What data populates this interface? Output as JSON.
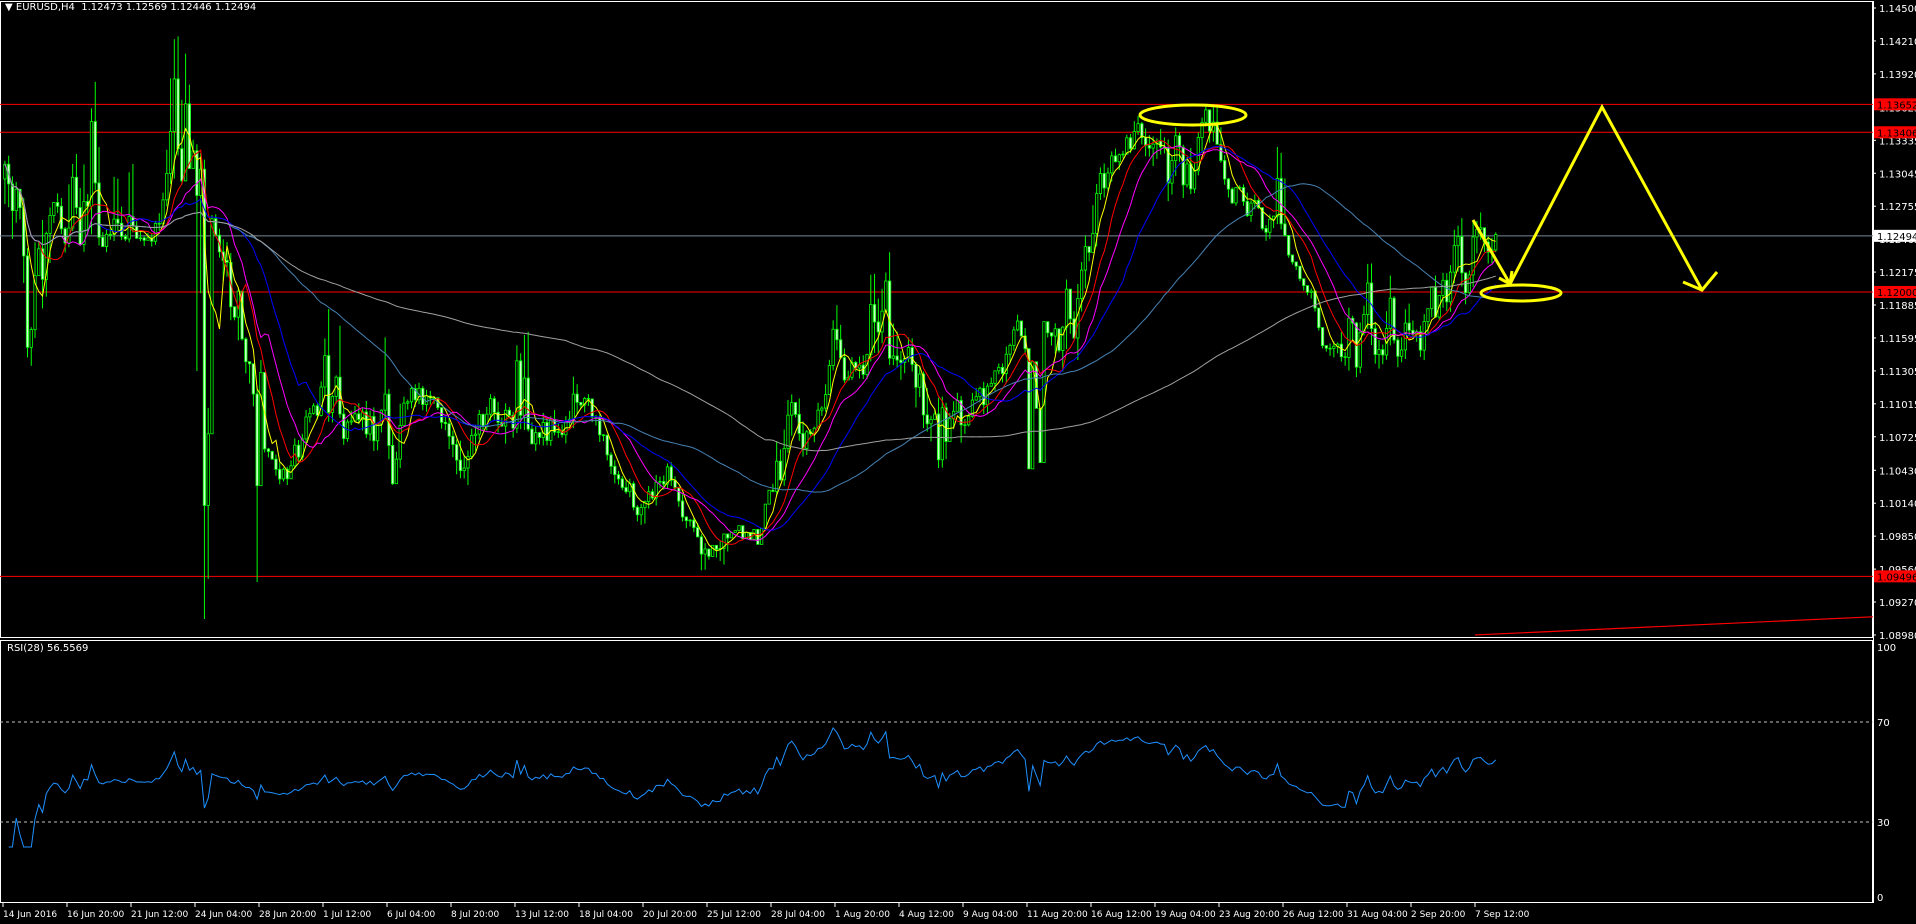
{
  "header": {
    "symbol": "EURUSD,H4",
    "ohlc_text": "1.12473 1.12569 1.12446 1.12494",
    "menu_icon": "triangle-down-icon"
  },
  "chart_data": {
    "type": "candlestick",
    "title": "EURUSD,H4",
    "ylim": [
      1.0898,
      1.145
    ],
    "grid": false,
    "colors": {
      "background": "#000000",
      "candle": "#00ff00",
      "bear_body": "#ccffcc",
      "axis": "#ffffff",
      "level_line": "#ff0000",
      "current_price_line": "#778899",
      "annotation": "#ffff00"
    },
    "x_tick_labels": [
      "14 Jun 2016",
      "16 Jun 20:00",
      "21 Jun 12:00",
      "24 Jun 04:00",
      "28 Jun 20:00",
      "1 Jul 12:00",
      "6 Jul 04:00",
      "8 Jul 20:00",
      "13 Jul 12:00",
      "18 Jul 04:00",
      "20 Jul 20:00",
      "25 Jul 12:00",
      "28 Jul 04:00",
      "1 Aug 20:00",
      "4 Aug 12:00",
      "9 Aug 04:00",
      "11 Aug 20:00",
      "16 Aug 12:00",
      "19 Aug 04:00",
      "23 Aug 20:00",
      "26 Aug 12:00",
      "31 Aug 04:00",
      "2 Sep 20:00",
      "7 Sep 12:00"
    ],
    "y_tick_labels": [
      "1.14500",
      "1.14210",
      "1.13920",
      "1.13625",
      "1.13335",
      "1.13045",
      "1.12755",
      "1.12465",
      "1.12175",
      "1.11885",
      "1.11595",
      "1.11305",
      "1.11015",
      "1.10725",
      "1.10430",
      "1.10140",
      "1.09850",
      "1.09560",
      "1.09270",
      "1.08980"
    ],
    "segments": [
      {
        "from": "14 Jun 2016",
        "open": 1.13,
        "high": 1.132,
        "low": 1.1135,
        "close": 1.1245
      },
      {
        "from": "16 Jun 20:00",
        "open": 1.1245,
        "high": 1.1385,
        "low": 1.1235,
        "close": 1.1265
      },
      {
        "from": "21 Jun 12:00",
        "open": 1.1265,
        "high": 1.1425,
        "low": 1.124,
        "close": 1.132
      },
      {
        "from": "24 Jun 04:00",
        "open": 1.132,
        "high": 1.133,
        "low": 1.0912,
        "close": 1.106
      },
      {
        "from": "28 Jun 20:00",
        "open": 1.106,
        "high": 1.114,
        "low": 1.103,
        "close": 1.111
      },
      {
        "from": "1 Jul 12:00",
        "open": 1.111,
        "high": 1.1185,
        "low": 1.106,
        "close": 1.111
      },
      {
        "from": "6 Jul 04:00",
        "open": 1.111,
        "high": 1.112,
        "low": 1.103,
        "close": 1.1075
      },
      {
        "from": "8 Jul 20:00",
        "open": 1.1075,
        "high": 1.111,
        "low": 1.103,
        "close": 1.108
      },
      {
        "from": "13 Jul 12:00",
        "open": 1.108,
        "high": 1.1165,
        "low": 1.106,
        "close": 1.11
      },
      {
        "from": "18 Jul 04:00",
        "open": 1.11,
        "high": 1.111,
        "low": 1.0995,
        "close": 1.101
      },
      {
        "from": "20 Jul 20:00",
        "open": 1.101,
        "high": 1.105,
        "low": 1.0955,
        "close": 1.0975
      },
      {
        "from": "25 Jul 12:00",
        "open": 1.0975,
        "high": 1.102,
        "low": 1.096,
        "close": 1.103
      },
      {
        "from": "28 Jul 04:00",
        "open": 1.103,
        "high": 1.1175,
        "low": 1.102,
        "close": 1.1165
      },
      {
        "from": "1 Aug 20:00",
        "open": 1.1165,
        "high": 1.1235,
        "low": 1.112,
        "close": 1.114
      },
      {
        "from": "4 Aug 12:00",
        "open": 1.114,
        "high": 1.116,
        "low": 1.1045,
        "close": 1.1085
      },
      {
        "from": "9 Aug 04:00",
        "open": 1.1085,
        "high": 1.118,
        "low": 1.1075,
        "close": 1.115
      },
      {
        "from": "11 Aug 20:00",
        "open": 1.115,
        "high": 1.123,
        "low": 1.113,
        "close": 1.127
      },
      {
        "from": "16 Aug 12:00",
        "open": 1.127,
        "high": 1.1355,
        "low": 1.124,
        "close": 1.133
      },
      {
        "from": "19 Aug 04:00",
        "open": 1.133,
        "high": 1.1365,
        "low": 1.128,
        "close": 1.133
      },
      {
        "from": "23 Aug 20:00",
        "open": 1.133,
        "high": 1.1345,
        "low": 1.1245,
        "close": 1.126
      },
      {
        "from": "26 Aug 12:00",
        "open": 1.126,
        "high": 1.13,
        "low": 1.1135,
        "close": 1.114
      },
      {
        "from": "31 Aug 04:00",
        "open": 1.114,
        "high": 1.1225,
        "low": 1.1125,
        "close": 1.1165
      },
      {
        "from": "2 Sep 20:00",
        "open": 1.1165,
        "high": 1.1265,
        "low": 1.114,
        "close": 1.1245
      },
      {
        "from": "7 Sep 12:00",
        "open": 1.1245,
        "high": 1.127,
        "low": 1.1225,
        "close": 1.12494
      }
    ],
    "moving_average_colors": [
      "#ffff00",
      "#ff0000",
      "#ff00ff",
      "#0000ff",
      "#4682b4",
      "#a0a0a0"
    ],
    "horizontal_lines": [
      {
        "label": "1.13652",
        "price": 1.13652,
        "color": "#ff0000"
      },
      {
        "label": "1.13406",
        "price": 1.13406,
        "color": "#ff0000"
      },
      {
        "label": "1.12000",
        "price": 1.12,
        "color": "#ff0000"
      },
      {
        "label": "1.09496",
        "price": 1.09496,
        "color": "#ff0000"
      }
    ],
    "current_price": {
      "label": "1.12494",
      "price": 1.12494,
      "color": "#778899"
    },
    "trendline": {
      "start_time": "7 Sep 12:00",
      "start_price": 1.0898,
      "end_price": 1.0914,
      "color": "#ff0000"
    },
    "rsi": {
      "label": "RSI(28) 56.5569",
      "color": "#1e90ff",
      "ylim": [
        0,
        100
      ],
      "levels": [
        70,
        30
      ],
      "tick_labels": [
        "100",
        "70",
        "30",
        "0"
      ]
    }
  }
}
